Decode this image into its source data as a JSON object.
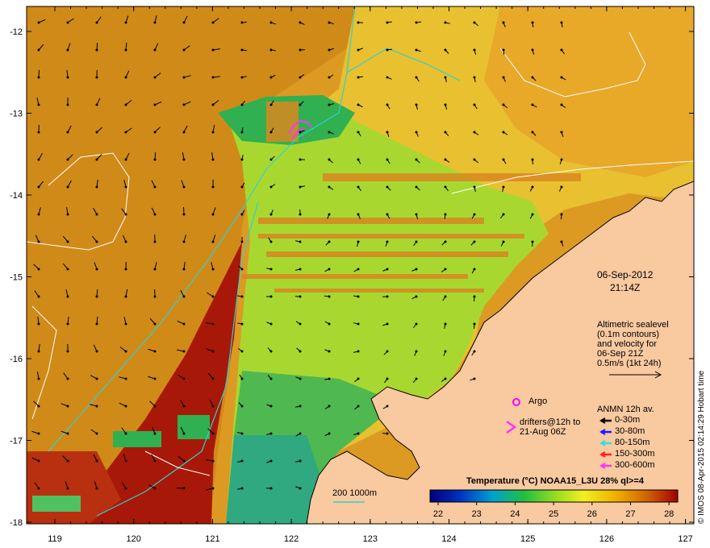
{
  "map": {
    "date": "06-Sep-2012",
    "time": "21:14Z",
    "credit": "© IMOS 08-Apr-2015 02:14:29 Hobart time",
    "lon_ticks": [
      "119",
      "120",
      "121",
      "122",
      "123",
      "124",
      "125",
      "126",
      "127"
    ],
    "lat_ticks": [
      "-12",
      "-13",
      "-14",
      "-15",
      "-16",
      "-17",
      "-18"
    ],
    "altimetry_note": [
      "Altimetric sealevel",
      "(0.1m contours)",
      "and velocity for",
      "06-Sep 21Z",
      "0.5m/s (1kt 24h)"
    ],
    "argo_label": "Argo",
    "drifters_label": [
      "drifters@12h to",
      "21-Aug 06Z"
    ],
    "anmn_title": "ANMN 12h av.",
    "anmn_legend": [
      {
        "label": "0-30m",
        "color": "#000000"
      },
      {
        "label": "30-80m",
        "color": "#1a1aff"
      },
      {
        "label": "80-150m",
        "color": "#33e0e0"
      },
      {
        "label": "150-300m",
        "color": "#ff2020"
      },
      {
        "label": "300-600m",
        "color": "#ff33ff"
      }
    ],
    "isobath_label": "200  1000m",
    "colorbar_title": "Temperature (°C) NOAA15_L3U 28% ql>=4",
    "colorbar_ticks": [
      "22",
      "23",
      "24",
      "25",
      "26",
      "27",
      "28"
    ],
    "colors": {
      "land": "#f9c9a0",
      "warm_sea": "#d98a10",
      "hot_sea": "#b02008",
      "isobath": "#30d0d0",
      "contour": "#ffffff"
    }
  }
}
